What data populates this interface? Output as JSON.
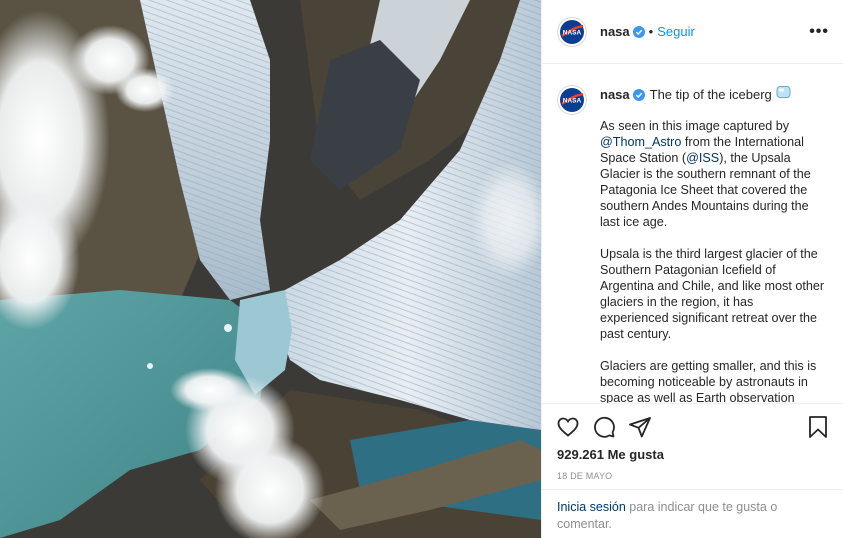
{
  "post": {
    "username": "nasa",
    "follow_label": "Seguir",
    "separator": "•",
    "more_label": "•••",
    "verified_icon": "verified-badge-icon"
  },
  "caption": {
    "username": "nasa",
    "title": "The tip of the iceberg",
    "emoji_icon": "ice-cube-icon",
    "p1_a": "As seen in this image captured by ",
    "p1_mention1": "@Thom_Astro",
    "p1_b": " from the International Space Station (",
    "p1_mention2": "@ISS",
    "p1_c": "), the Upsala Glacier is the southern remnant of the Patagonia Ice Sheet that covered the southern Andes Mountains during the last ice age.",
    "p2": "Upsala is the third largest glacier of the Southern Patagonian Icefield of Argentina and Chile, and like most other glaciers in the region, it has experienced significant retreat over the past century.",
    "p3": "Glaciers are getting smaller, and this is becoming noticeable by astronauts in space as well as Earth observation"
  },
  "stats": {
    "likes": "929.261 Me gusta",
    "date": "18 DE MAYO"
  },
  "login": {
    "link": "Inicia sesión",
    "text": " para indicar que te gusta o comentar."
  },
  "colors": {
    "link_blue": "#0095f6",
    "mention_blue": "#00376b",
    "muted": "#8e8e8e",
    "border": "#efefef"
  }
}
